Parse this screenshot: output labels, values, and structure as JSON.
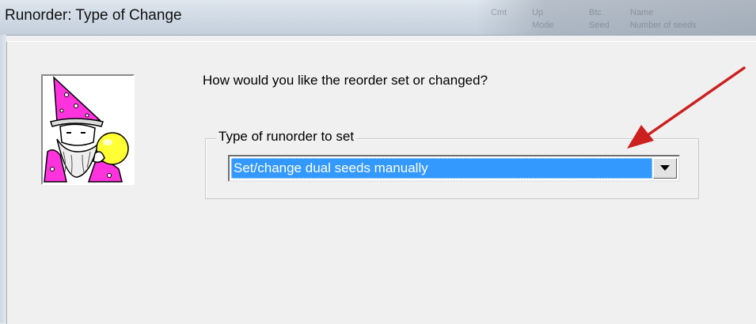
{
  "window": {
    "title": "Runorder: Type of Change",
    "background_text": [
      "Cmt",
      "Up",
      "Btc",
      "Name",
      "Mode",
      "Seed",
      "Number of seeds"
    ]
  },
  "wizard_image": {
    "icon": "wizard-icon"
  },
  "dialog": {
    "question": "How would you like the reorder set or changed?",
    "group_label": "Type of runorder to set",
    "combo_selected": "Set/change dual seeds manually",
    "dropdown_icon": "chevron-down-icon"
  },
  "annotation": {
    "icon": "red-arrow-icon",
    "color": "#cc2020"
  },
  "colors": {
    "selection": "#3399ff",
    "titlebar": "#cfd9e4",
    "face": "#f0f0f0"
  }
}
